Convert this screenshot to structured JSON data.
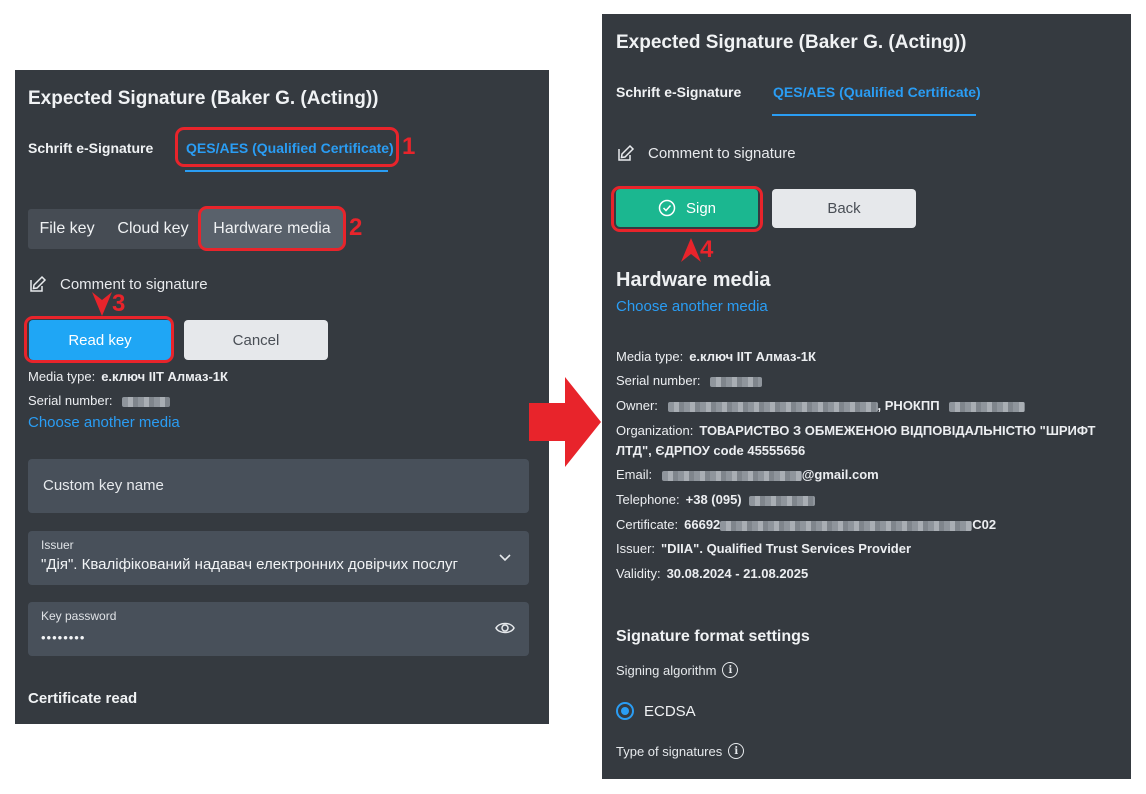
{
  "colors": {
    "panel": "#353a40",
    "accent": "#2a9df4",
    "annotation": "#e8242b",
    "sign_green": "#1bb790",
    "read_blue": "#1fa6f5"
  },
  "left": {
    "title": "Expected Signature (Baker G. (Acting))",
    "tabs": [
      {
        "label": "Schrift e-Signature"
      },
      {
        "label": "QES/AES (Qualified Certificate)"
      }
    ],
    "key_types": [
      {
        "label": "File key"
      },
      {
        "label": "Cloud key"
      },
      {
        "label": "Hardware media"
      }
    ],
    "comment_label": "Comment to signature",
    "read_key_label": "Read key",
    "cancel_label": "Cancel",
    "media_type_label": "Media type:",
    "media_type_value": "е.ключ ІІТ Алмаз-1К",
    "serial_label": "Serial number:",
    "choose_media_label": "Choose another media",
    "custom_key_placeholder": "Custom key name",
    "issuer_label": "Issuer",
    "issuer_value": "\"Дія\". Кваліфікований надавач електронних довірчих послуг",
    "password_label": "Key password",
    "password_value": "••••••••",
    "certificate_read_label": "Certificate read",
    "icons": {
      "comment": "edit-note-icon",
      "dropdown": "chevron-down-icon",
      "eye": "eye-icon"
    }
  },
  "right": {
    "title": "Expected Signature (Baker G. (Acting))",
    "tabs": [
      {
        "label": "Schrift e-Signature"
      },
      {
        "label": "QES/AES (Qualified Certificate)"
      }
    ],
    "comment_label": "Comment to signature",
    "sign_label": "Sign",
    "back_label": "Back",
    "hardware_title": "Hardware media",
    "choose_media_label": "Choose another media",
    "details": {
      "media_type_label": "Media type:",
      "media_type_value": "е.ключ ІІТ Алмаз-1К",
      "serial_label": "Serial number:",
      "owner_label": "Owner:",
      "owner_suffix": ", РНОКПП",
      "organization_label": "Organization:",
      "organization_line1": "ТОВАРИСТВО З ОБМЕЖЕНОЮ ВІДПОВІДАЛЬНІСТЮ \"ШРИФТ",
      "organization_line2": "ЛТД\", ЄДРПОУ code 45555656",
      "email_label": "Email:",
      "email_suffix": "@gmail.com",
      "telephone_label": "Telephone:",
      "telephone_prefix": "+38 (095)",
      "certificate_label": "Certificate:",
      "certificate_prefix": "66692",
      "certificate_suffix": "C02",
      "issuer_label": "Issuer:",
      "issuer_value": "\"DIIA\". Qualified Trust Services Provider",
      "validity_label": "Validity:",
      "validity_value": "30.08.2024 - 21.08.2025"
    },
    "format_title": "Signature format settings",
    "signing_algorithm_label": "Signing algorithm",
    "algorithm_option": "ECDSA",
    "type_of_signatures_label": "Type of signatures",
    "icons": {
      "comment": "edit-note-icon",
      "check": "check-circle-icon",
      "info": "info-icon"
    }
  },
  "annotations": {
    "step1": "1",
    "step2": "2",
    "step3": "3",
    "step4": "4"
  }
}
